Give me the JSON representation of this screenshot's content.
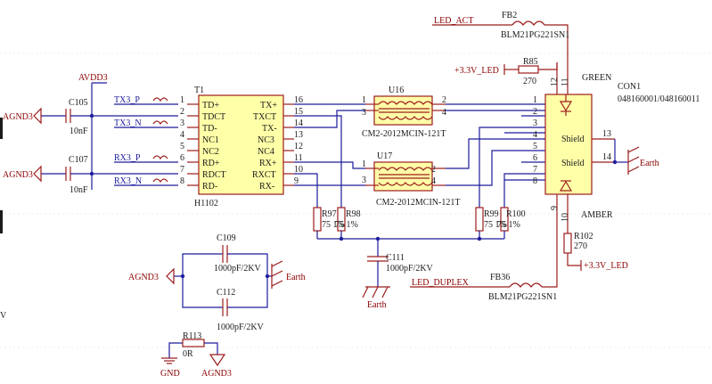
{
  "nets": {
    "led_act": "LED_ACT",
    "led_duplex": "LED_DUPLEX",
    "v33_led_top": "+3.3V_LED",
    "v33_led_bottom": "+3.3V_LED",
    "avdd3": "AVDD3",
    "agnd3_a": "AGND3",
    "agnd3_b": "AGND3",
    "agnd3_c": "AGND3",
    "agnd3_d": "AGND3",
    "gnd": "GND",
    "earth_a": "Earth",
    "earth_b": "Earth",
    "earth_c": "Earth",
    "tx3_p": "TX3_P",
    "tx3_n": "TX3_N",
    "rx3_p": "RX3_P",
    "rx3_n": "RX3_N",
    "edge_v": "V"
  },
  "t1": {
    "ref": "T1",
    "part": "H1102",
    "left_pins": [
      {
        "num": "1",
        "name": "TD+"
      },
      {
        "num": "2",
        "name": "TDCT"
      },
      {
        "num": "3",
        "name": "TD-"
      },
      {
        "num": "4",
        "name": "NC1"
      },
      {
        "num": "5",
        "name": "NC2"
      },
      {
        "num": "6",
        "name": "RD+"
      },
      {
        "num": "7",
        "name": "RDCT"
      },
      {
        "num": "8",
        "name": "RD-"
      }
    ],
    "right_pins": [
      {
        "num": "16",
        "name": "TX+"
      },
      {
        "num": "15",
        "name": "TXCT"
      },
      {
        "num": "14",
        "name": "TX-"
      },
      {
        "num": "13",
        "name": "NC3"
      },
      {
        "num": "12",
        "name": "NC4"
      },
      {
        "num": "11",
        "name": "RX+"
      },
      {
        "num": "10",
        "name": "RXCT"
      },
      {
        "num": "9",
        "name": "RX-"
      }
    ]
  },
  "u16": {
    "ref": "U16",
    "part": "CM2-2012MCIN-121T",
    "pins": [
      "1",
      "2",
      "3",
      "4"
    ]
  },
  "u17": {
    "ref": "U17",
    "part": "CM2-2012MCIN-121T",
    "pins": [
      "1",
      "2",
      "3",
      "4"
    ]
  },
  "con1": {
    "ref": "CON1",
    "part": "048160001/048160011",
    "led_green": "GREEN",
    "led_amber": "AMBER",
    "shield_top": "Shield",
    "shield_bottom": "Shield",
    "pins_left": [
      "1",
      "2",
      "3",
      "4",
      "5",
      "6",
      "7",
      "8"
    ],
    "pin_12": "12",
    "pin_11": "11",
    "pin_13": "13",
    "pin_14": "14",
    "pin_9": "9",
    "pin_10": "10"
  },
  "fb2": {
    "ref": "FB2",
    "part": "BLM21PG221SN1"
  },
  "fb36": {
    "ref": "FB36",
    "part": "BLM21PG221SN1"
  },
  "r85": {
    "ref": "R85",
    "value": "270"
  },
  "r102": {
    "ref": "R102",
    "value": "270"
  },
  "r97": {
    "ref": "R97",
    "value": "75 1%"
  },
  "r98": {
    "ref": "R98",
    "value": "75 1%"
  },
  "r99": {
    "ref": "R99",
    "value": "75 1%"
  },
  "r100": {
    "ref": "R100",
    "value": "75 1%"
  },
  "r113": {
    "ref": "R113",
    "value": "0R"
  },
  "c105": {
    "ref": "C105",
    "value": "10nF"
  },
  "c107": {
    "ref": "C107",
    "value": "10nF"
  },
  "c109": {
    "ref": "C109",
    "value": "1000pF/2KV"
  },
  "c111": {
    "ref": "C111",
    "value": "1000pF/2KV"
  },
  "c112": {
    "ref": "C112",
    "value": "1000pF/2KV"
  },
  "colors": {
    "wire": "#1c1c9c",
    "part": "#9c1c1c",
    "body_fill": "#ffffa8",
    "label": "#8b0000"
  }
}
